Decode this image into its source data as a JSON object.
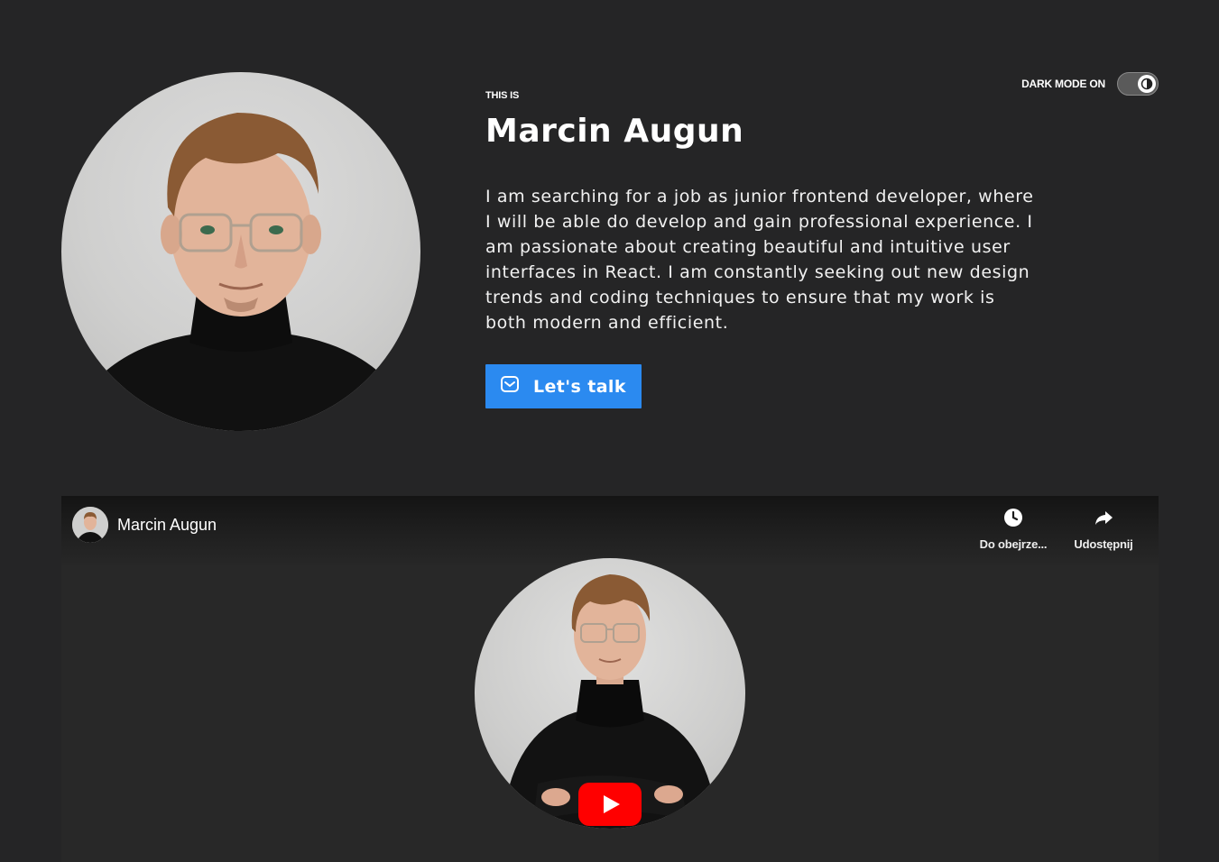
{
  "hero": {
    "eyebrow": "THIS IS",
    "name": "Marcin Augun",
    "bio": "I am searching for a job as junior frontend developer, where I will be able do develop and gain professional experience. I am passionate about creating beautiful and intuitive user interfaces in React. I am constantly seeking out new design trends and coding techniques to ensure that my work is both modern and efficient.",
    "cta_label": "Let's talk",
    "cta_icon": "mail-icon"
  },
  "dark_mode": {
    "label": "DARK MODE ON",
    "enabled": true,
    "icon": "contrast-icon"
  },
  "video": {
    "channel_name": "Marcin Augun",
    "watch_later_label": "Do obejrze...",
    "share_label": "Udostępnij",
    "icons": [
      "clock-icon",
      "share-arrow-icon",
      "play-icon"
    ]
  },
  "colors": {
    "background": "#252526",
    "accent": "#2b8af0",
    "youtube_red": "#ff0000"
  }
}
